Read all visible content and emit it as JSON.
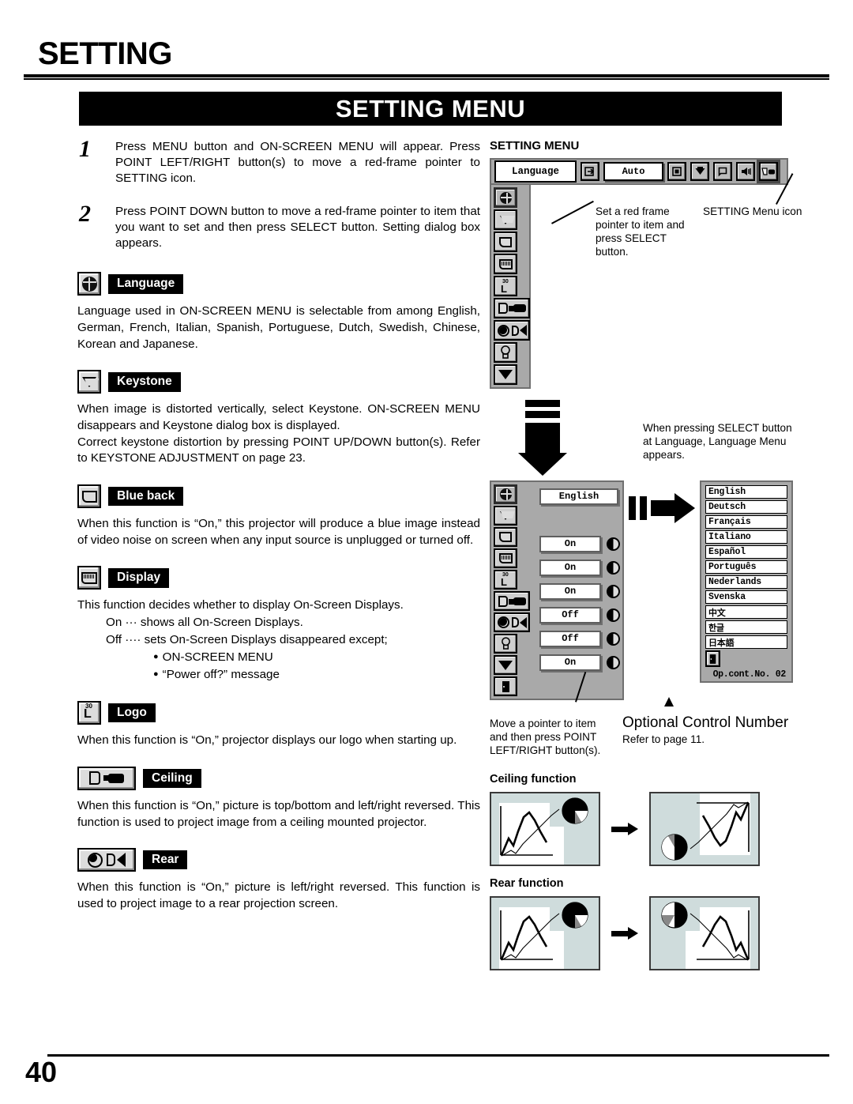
{
  "page": {
    "title": "SETTING",
    "banner": "SETTING MENU",
    "number": "40"
  },
  "steps": [
    {
      "num": "1",
      "text": "Press MENU button and ON-SCREEN MENU will appear.  Press POINT LEFT/RIGHT button(s) to move a red-frame pointer to SETTING icon."
    },
    {
      "num": "2",
      "text": "Press POINT DOWN button to move a red-frame pointer to item that you want to set and then press SELECT button.  Setting dialog box appears."
    }
  ],
  "sections": {
    "language": {
      "label": "Language",
      "icon": "globe-icon",
      "body": "Language used in ON-SCREEN MENU is selectable from among English, German, French, Italian, Spanish, Portuguese, Dutch, Swedish, Chinese, Korean and Japanese."
    },
    "keystone": {
      "label": "Keystone",
      "icon": "keystone-icon",
      "body_line1": "When image is distorted vertically, select Keystone.  ON-SCREEN MENU disappears and Keystone dialog box is displayed.",
      "body_line2": "Correct keystone distortion by pressing POINT UP/DOWN button(s). Refer to KEYSTONE ADJUSTMENT on page 23."
    },
    "blue_back": {
      "label": "Blue back",
      "icon": "blue-back-icon",
      "body": "When this function is “On,” this projector will produce a blue image instead of video noise on screen when any input source is unplugged or turned off."
    },
    "display": {
      "label": "Display",
      "icon": "display-icon",
      "body": "This function decides whether to display On-Screen Displays.",
      "on_line": "On  ··· shows all On-Screen Displays.",
      "off_line": "Off ···· sets On-Screen Displays disappeared except;",
      "bullets": [
        "ON-SCREEN MENU",
        "“Power off?” message"
      ]
    },
    "logo": {
      "label": "Logo",
      "icon": "logo-icon",
      "icon_sub": "30",
      "icon_main": "L",
      "body": "When this function is “On,” projector displays our logo when starting up."
    },
    "ceiling": {
      "label": "Ceiling",
      "icon": "ceiling-icon",
      "body": "When this function is “On,” picture is top/bottom and left/right reversed. This function is used to project image from a ceiling mounted projector."
    },
    "rear": {
      "label": "Rear",
      "icon": "rear-icon",
      "body": "When this function is “On,” picture is left/right reversed.  This function is used to project image to a rear projection screen."
    }
  },
  "diagram": {
    "heading": "SETTING MENU",
    "menubar": {
      "tab_label": "Language",
      "auto_label": "Auto",
      "icons": [
        "input-icon",
        "image-icon",
        "screen-icon",
        "sound-icon",
        "setting-icon"
      ],
      "selected_icon": "setting-icon"
    },
    "annotations": {
      "red_frame": "Set a red frame pointer to item and press SELECT button.",
      "menu_icon": "SETTING Menu icon",
      "select_note": "When pressing SELECT button at Language, Language Menu appears.",
      "pointer_note": "Move a pointer to item and then press POINT LEFT/RIGHT button(s).",
      "optional_title": "Optional Control Number",
      "optional_sub": "Refer to page 11."
    },
    "sidebar_icons": [
      "globe-icon",
      "keystone-icon",
      "blue-back-icon",
      "display-icon",
      "logo-icon",
      "ceiling-icon",
      "rear-icon",
      "lamp-icon",
      "scroll-down-icon"
    ],
    "dialog_rows": [
      {
        "icon": "globe-icon",
        "value": "English",
        "has_lr": false
      },
      {
        "icon": "keystone-icon",
        "value": "",
        "has_lr": false
      },
      {
        "icon": "blue-back-icon",
        "value": "On",
        "has_lr": true
      },
      {
        "icon": "display-icon",
        "value": "On",
        "has_lr": true
      },
      {
        "icon": "logo-icon",
        "value": "On",
        "has_lr": true
      },
      {
        "icon": "ceiling-icon",
        "value": "Off",
        "has_lr": true
      },
      {
        "icon": "rear-icon",
        "value": "Off",
        "has_lr": true
      },
      {
        "icon": "lamp-icon",
        "value": "On",
        "has_lr": true
      },
      {
        "icon": "scroll-down-icon",
        "value": "",
        "has_lr": false
      },
      {
        "icon": "exit-icon",
        "value": "",
        "has_lr": false
      }
    ],
    "languages": [
      "English",
      "Deutsch",
      "Français",
      "Italiano",
      "Español",
      "Português",
      "Nederlands",
      "Svenska",
      "中文",
      "한글",
      "日本語"
    ],
    "op_control_number": "Op.cont.No. 02"
  },
  "illustrations": {
    "ceiling_title": "Ceiling function",
    "rear_title": "Rear function",
    "fill_color": "#cfdcdc"
  }
}
